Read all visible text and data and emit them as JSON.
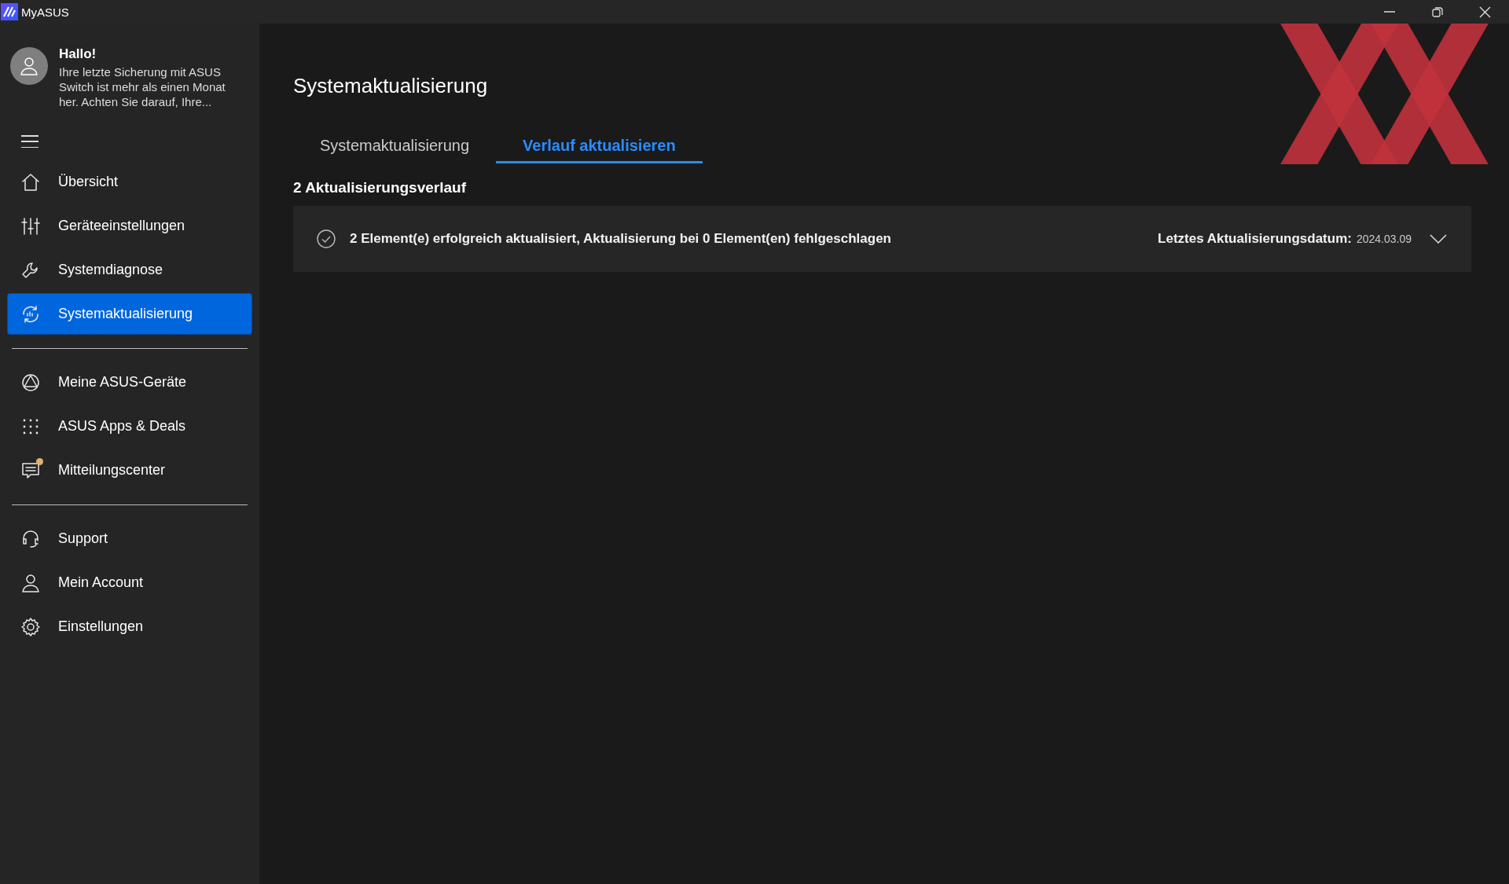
{
  "window": {
    "title": "MyASUS"
  },
  "profile": {
    "greeting": "Hallo!",
    "message": "Ihre letzte Sicherung mit ASUS Switch ist mehr als einen Monat her. Achten Sie darauf, Ihre..."
  },
  "sidebar": {
    "groups": [
      {
        "items": [
          {
            "label": "Übersicht",
            "selected": false,
            "badge": false
          },
          {
            "label": "Geräteeinstellungen",
            "selected": false,
            "badge": false
          },
          {
            "label": "Systemdiagnose",
            "selected": false,
            "badge": false
          },
          {
            "label": "Systemaktualisierung",
            "selected": true,
            "badge": false
          }
        ]
      },
      {
        "items": [
          {
            "label": "Meine ASUS-Geräte",
            "selected": false,
            "badge": false
          },
          {
            "label": "ASUS Apps & Deals",
            "selected": false,
            "badge": false
          },
          {
            "label": "Mitteilungscenter",
            "selected": false,
            "badge": true
          }
        ]
      },
      {
        "items": [
          {
            "label": "Support",
            "selected": false,
            "badge": false
          },
          {
            "label": "Mein Account",
            "selected": false,
            "badge": false
          },
          {
            "label": "Einstellungen",
            "selected": false,
            "badge": false
          }
        ]
      }
    ]
  },
  "page": {
    "title": "Systemaktualisierung",
    "tabs": [
      {
        "label": "Systemaktualisierung",
        "selected": false
      },
      {
        "label": "Verlauf aktualisieren",
        "selected": true
      }
    ],
    "section_title": "2 Aktualisierungsverlauf",
    "history": [
      {
        "summary": "2 Element(e) erfolgreich aktualisiert, Aktualisierung bei 0 Element(en) fehlgeschlagen",
        "date_label": "Letztes Aktualisierungsdatum:",
        "date": "2024.03.09",
        "expanded": false
      }
    ]
  }
}
